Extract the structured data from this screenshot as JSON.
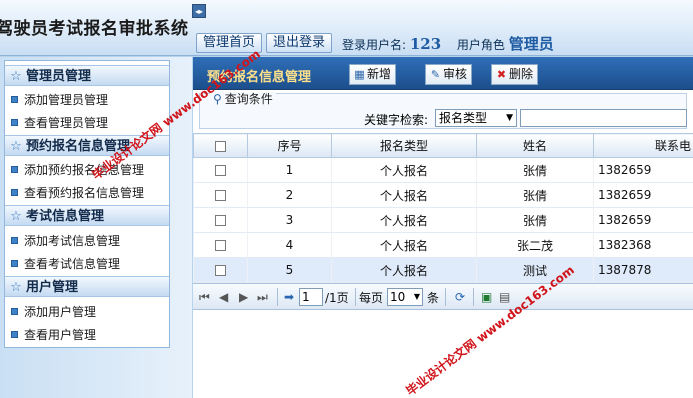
{
  "app": {
    "title": "驾驶员考试报名审批系统",
    "collapse_icon": "◂▸"
  },
  "header": {
    "home_button": "管理首页",
    "logout_button": "退出登录",
    "login_user_label": "登录用户名:",
    "login_user_value": "123",
    "user_role_label": "用户角色",
    "user_role_value": "管理员"
  },
  "sidebar": {
    "groups": [
      {
        "label": "管理员管理",
        "items": [
          "添加管理员管理",
          "查看管理员管理"
        ]
      },
      {
        "label": "预约报名信息管理",
        "items": [
          "添加预约报名信息管理",
          "查看预约报名信息管理"
        ]
      },
      {
        "label": "考试信息管理",
        "items": [
          "添加考试信息管理",
          "查看考试信息管理"
        ]
      },
      {
        "label": "用户管理",
        "items": [
          "添加用户管理",
          "查看用户管理"
        ]
      }
    ]
  },
  "main": {
    "title": "预约报名信息管理",
    "toolbar": {
      "add_label": "新增",
      "audit_label": "审核",
      "delete_label": "删除"
    },
    "search": {
      "legend": "查询条件",
      "keyword_label": "关键字检索:",
      "keyword_select_value": "报名类型",
      "keyword_input_value": ""
    },
    "table": {
      "columns": [
        "",
        "序号",
        "报名类型",
        "姓名",
        "联系电"
      ],
      "rows": [
        {
          "no": "1",
          "type": "个人报名",
          "name": "张倩",
          "phone": "1382659"
        },
        {
          "no": "2",
          "type": "个人报名",
          "name": "张倩",
          "phone": "1382659"
        },
        {
          "no": "3",
          "type": "个人报名",
          "name": "张倩",
          "phone": "1382659"
        },
        {
          "no": "4",
          "type": "个人报名",
          "name": "张二茂",
          "phone": "1382368"
        },
        {
          "no": "5",
          "type": "个人报名",
          "name": "测试",
          "phone": "1387878"
        }
      ]
    },
    "pager": {
      "first_icon": "⏮",
      "prev_icon": "◀",
      "next_icon": "▶",
      "last_icon": "⏭",
      "page_value": "1",
      "page_suffix": "/1页",
      "per_page_label": "每页",
      "per_page_value": "10",
      "per_page_suffix": "条"
    }
  },
  "watermark": {
    "text": "毕业设计论文网 www.doc163.com"
  },
  "colors": {
    "title_bar": "#2f6fb8",
    "title_text": "#ffe08a",
    "watermark": "#d0141a",
    "selected_row": "#dfeafa"
  }
}
